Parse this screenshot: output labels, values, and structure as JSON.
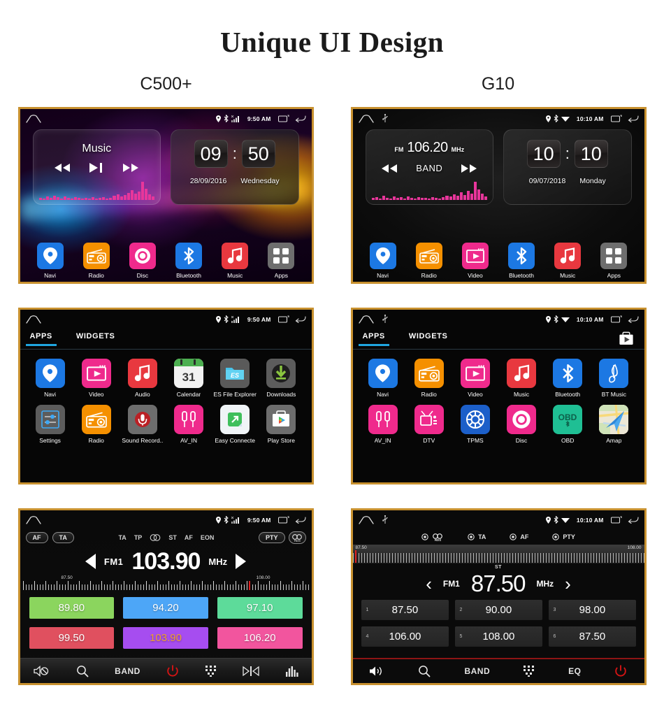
{
  "header": {
    "title": "Unique UI Design",
    "columns": [
      "C500+",
      "G10"
    ]
  },
  "colors": {
    "frame_border": "#c8912f",
    "accent_tab": "#1fa6e0",
    "power_red": "#d41414",
    "navi_blue": "#1c78e3",
    "radio_orange": "#f59000",
    "video_pink": "#ef2a8c",
    "bluetooth_blue": "#1c78e3",
    "music_red": "#e8383f",
    "apps_grey": "#6e6e6e",
    "disc_pink": "#ef2a8c",
    "obd_teal": "#1fbf94"
  },
  "c500_home": {
    "status": {
      "time": "9:50 AM",
      "icons": [
        "location-icon",
        "bluetooth-icon",
        "signal-icon",
        "recents-icon",
        "back-icon"
      ]
    },
    "music_widget": {
      "title": "Music",
      "prev": "◀◀",
      "playpause": "▶❙",
      "next": "▶▶"
    },
    "clock_widget": {
      "hours": "09",
      "colon": ":",
      "minutes": "50",
      "date": "28/09/2016",
      "weekday": "Wednesday"
    },
    "dock": [
      {
        "label": "Navi",
        "icon": "navi-icon"
      },
      {
        "label": "Radio",
        "icon": "radio-icon"
      },
      {
        "label": "Disc",
        "icon": "disc-icon"
      },
      {
        "label": "Bluetooth",
        "icon": "bluetooth-icon"
      },
      {
        "label": "Music",
        "icon": "music-icon"
      },
      {
        "label": "Apps",
        "icon": "apps-grid-icon"
      }
    ]
  },
  "g10_home": {
    "status": {
      "time": "10:10 AM",
      "icons": [
        "location-icon",
        "bluetooth-icon",
        "wifi-icon",
        "recents-icon",
        "back-icon"
      ]
    },
    "radio_widget": {
      "band_prefix": "FM",
      "frequency": "106.20",
      "unit": "MHz",
      "prev": "◀◀",
      "band": "BAND",
      "next": "▶▶"
    },
    "clock_widget": {
      "hours": "10",
      "colon": ":",
      "minutes": "10",
      "date": "09/07/2018",
      "weekday": "Monday"
    },
    "dock": [
      {
        "label": "Navi",
        "icon": "navi-icon"
      },
      {
        "label": "Radio",
        "icon": "radio-icon"
      },
      {
        "label": "Video",
        "icon": "video-icon"
      },
      {
        "label": "Bluetooth",
        "icon": "bluetooth-icon"
      },
      {
        "label": "Music",
        "icon": "music-icon"
      },
      {
        "label": "Apps",
        "icon": "apps-grid-icon"
      }
    ]
  },
  "c500_apps": {
    "status": {
      "time": "9:50 AM"
    },
    "tabs": [
      {
        "label": "APPS",
        "active": true
      },
      {
        "label": "WIDGETS",
        "active": false
      }
    ],
    "rows": [
      [
        {
          "label": "Navi",
          "icon": "navi-icon"
        },
        {
          "label": "Video",
          "icon": "video-icon"
        },
        {
          "label": "Audio",
          "icon": "music-icon"
        },
        {
          "label": "Calendar",
          "icon": "calendar-icon"
        },
        {
          "label": "ES File Explorer",
          "icon": "file-explorer-icon"
        },
        {
          "label": "Downloads",
          "icon": "downloads-icon"
        }
      ],
      [
        {
          "label": "Settings",
          "icon": "settings-icon"
        },
        {
          "label": "Radio",
          "icon": "radio-icon"
        },
        {
          "label": "Sound Record..",
          "icon": "microphone-icon"
        },
        {
          "label": "AV_IN",
          "icon": "av-in-icon"
        },
        {
          "label": "Easy Connecte",
          "icon": "easy-connect-icon"
        },
        {
          "label": "Play Store",
          "icon": "play-store-icon"
        }
      ]
    ]
  },
  "g10_apps": {
    "status": {
      "time": "10:10 AM"
    },
    "tabs": [
      {
        "label": "APPS",
        "active": true
      },
      {
        "label": "WIDGETS",
        "active": false
      }
    ],
    "playstore_icon": "play-store-bag-icon",
    "rows": [
      [
        {
          "label": "Navi",
          "icon": "navi-icon"
        },
        {
          "label": "Radio",
          "icon": "radio-icon"
        },
        {
          "label": "Video",
          "icon": "video-icon"
        },
        {
          "label": "Music",
          "icon": "music-icon"
        },
        {
          "label": "Bluetooth",
          "icon": "bluetooth-icon"
        },
        {
          "label": "BT Music",
          "icon": "bt-music-icon"
        }
      ],
      [
        {
          "label": "AV_IN",
          "icon": "av-in-icon"
        },
        {
          "label": "DTV",
          "icon": "dtv-icon"
        },
        {
          "label": "TPMS",
          "icon": "tpms-icon"
        },
        {
          "label": "Disc",
          "icon": "disc-icon"
        },
        {
          "label": "OBD",
          "icon": "obd-icon"
        },
        {
          "label": "Amap",
          "icon": "amap-icon"
        }
      ]
    ]
  },
  "c500_radio": {
    "status": {
      "time": "9:50 AM"
    },
    "left_buttons": [
      "AF",
      "TA"
    ],
    "flags": [
      "TA",
      "TP",
      "stereo-icon",
      "ST",
      "AF",
      "EON"
    ],
    "right_buttons": [
      "PTY",
      "rds-icon"
    ],
    "tuner": {
      "band": "FM1",
      "frequency": "103.90",
      "unit": "MHz",
      "prev": "prev-triangle-icon",
      "next": "next-triangle-icon"
    },
    "scale": {
      "min": "87.50",
      "max": "108.00",
      "marker_percent": 79
    },
    "presets": [
      [
        {
          "value": "89.80",
          "color": "#8BD55E",
          "text_color": "#ffffff"
        },
        {
          "value": "94.20",
          "color": "#4DA6F7",
          "text_color": "#ffffff"
        },
        {
          "value": "97.10",
          "color": "#5DDB9A",
          "text_color": "#ffffff"
        }
      ],
      [
        {
          "value": "99.50",
          "color": "#E0505F",
          "text_color": "#ffffff"
        },
        {
          "value": "103.90",
          "color": "#A64DF0",
          "text_color": "#f0a030"
        },
        {
          "value": "106.20",
          "color": "#F2559E",
          "text_color": "#ffffff"
        }
      ]
    ],
    "bottom_bar": [
      {
        "name": "mute-icon",
        "label": ""
      },
      {
        "name": "search-icon",
        "label": ""
      },
      {
        "name": "band-label",
        "label": "BAND"
      },
      {
        "name": "power-icon",
        "label": ""
      },
      {
        "name": "keypad-icon",
        "label": ""
      },
      {
        "name": "scan-icon",
        "label": ""
      },
      {
        "name": "equalizer-icon",
        "label": ""
      }
    ]
  },
  "g10_radio": {
    "status": {
      "time": "10:10 AM"
    },
    "rds_items": [
      {
        "icon": "radio-dot-icon",
        "label": "rds-logo-icon"
      },
      {
        "icon": "radio-dot-icon",
        "label": "TA"
      },
      {
        "icon": "radio-dot-icon",
        "label": "AF"
      },
      {
        "icon": "radio-dot-icon",
        "label": "PTY"
      }
    ],
    "scale": {
      "min": "87.50",
      "max": "108.00",
      "marker_percent": 0.5
    },
    "tuner": {
      "stereo": "ST",
      "band": "FM1",
      "frequency": "87.50",
      "unit": "MHz",
      "prev": "‹",
      "next": "›"
    },
    "presets": [
      [
        {
          "index": "1",
          "value": "87.50"
        },
        {
          "index": "2",
          "value": "90.00"
        },
        {
          "index": "3",
          "value": "98.00"
        }
      ],
      [
        {
          "index": "4",
          "value": "106.00"
        },
        {
          "index": "5",
          "value": "108.00"
        },
        {
          "index": "6",
          "value": "87.50"
        }
      ]
    ],
    "bottom_bar": [
      {
        "name": "volume-icon",
        "label": ""
      },
      {
        "name": "search-icon",
        "label": ""
      },
      {
        "name": "band-label",
        "label": "BAND"
      },
      {
        "name": "keypad-icon",
        "label": ""
      },
      {
        "name": "eq-label",
        "label": "EQ"
      },
      {
        "name": "power-icon",
        "label": ""
      }
    ]
  }
}
